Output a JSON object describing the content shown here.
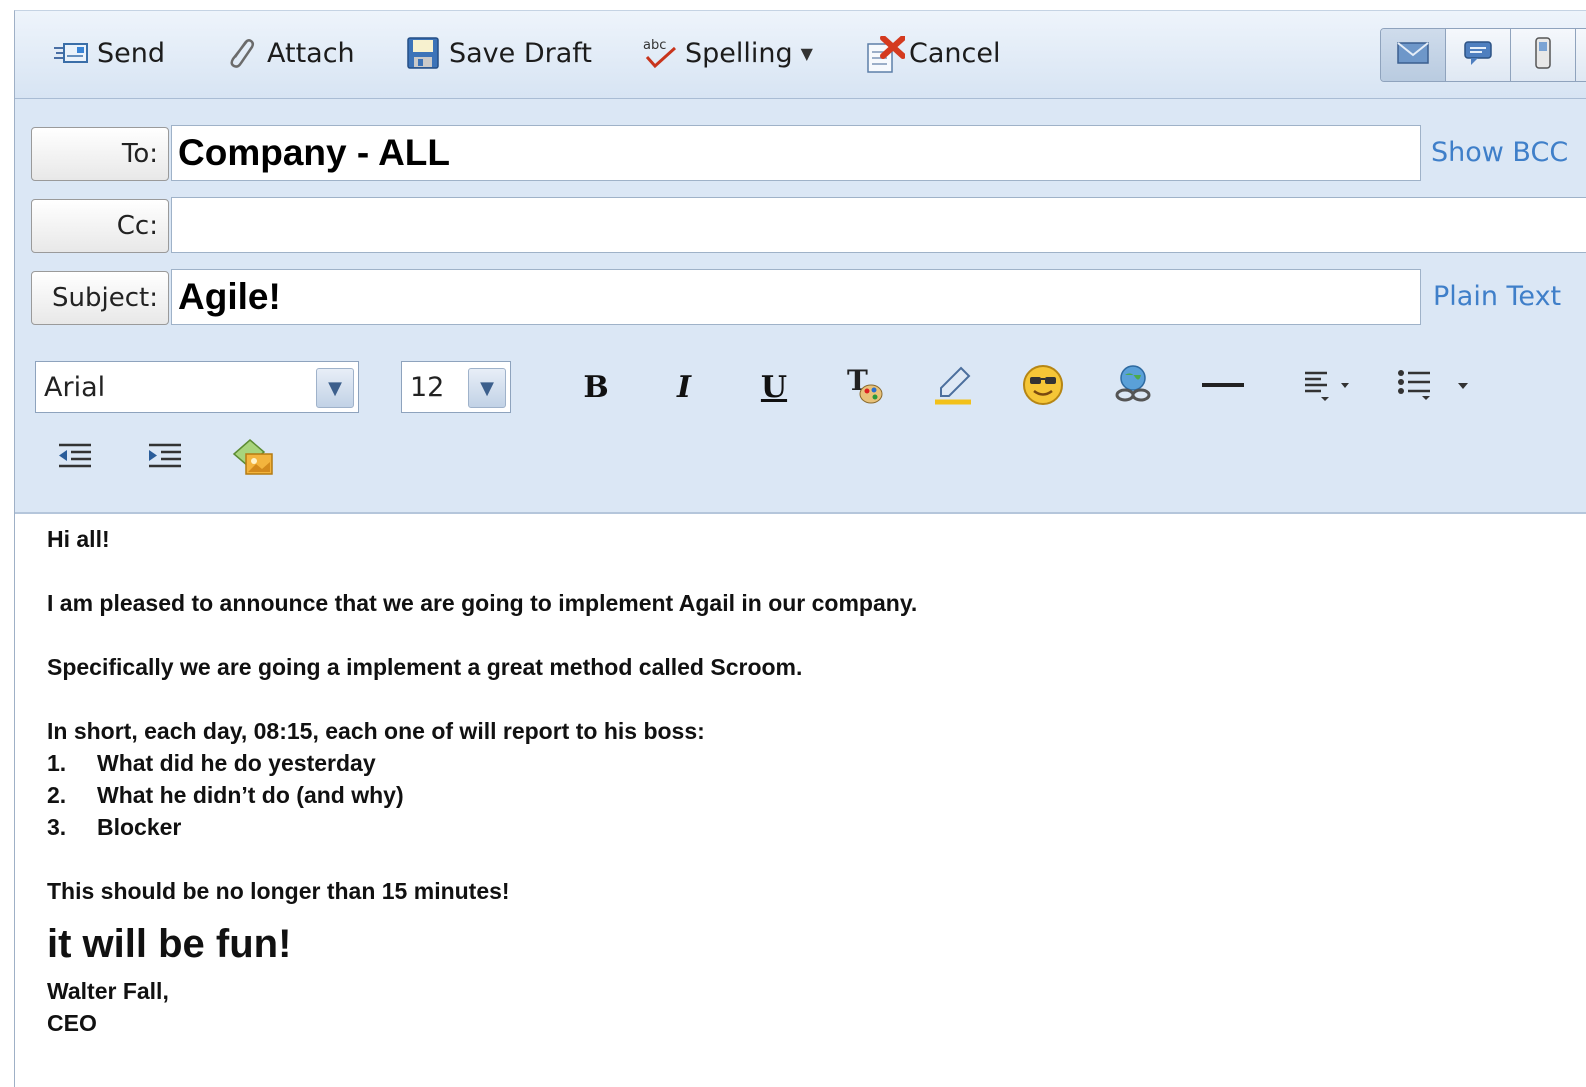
{
  "toolbar": {
    "send_label": "Send",
    "attach_label": "Attach",
    "save_draft_label": "Save Draft",
    "spelling_label": "Spelling",
    "cancel_label": "Cancel"
  },
  "compose": {
    "to_label": "To:",
    "to_value": "Company - ALL",
    "cc_label": "Cc:",
    "cc_value": "",
    "subject_label": "Subject:",
    "subject_value": "Agile!",
    "show_bcc_link": "Show BCC",
    "plain_text_link": "Plain Text"
  },
  "format": {
    "font": "Arial",
    "size": "12",
    "bold": "B",
    "italic": "I",
    "underline": "U"
  },
  "message": {
    "greeting": "Hi all!",
    "line1": "I am pleased to announce that we are going to implement Agail in our company.",
    "line2": "Specifically we are going a implement a great method called Scroom.",
    "line3": "In short, each day, 08:15, each one of will report to his boss:",
    "list": [
      {
        "num": "1.",
        "text": "What did he do yesterday"
      },
      {
        "num": "2.",
        "text": "What he didn’t do (and why)"
      },
      {
        "num": "3.",
        "text": "Blocker"
      }
    ],
    "line4": "This should be no longer than 15 minutes!",
    "headline": "it will be fun!",
    "signature_name": "Walter Fall,",
    "signature_title": "CEO"
  }
}
